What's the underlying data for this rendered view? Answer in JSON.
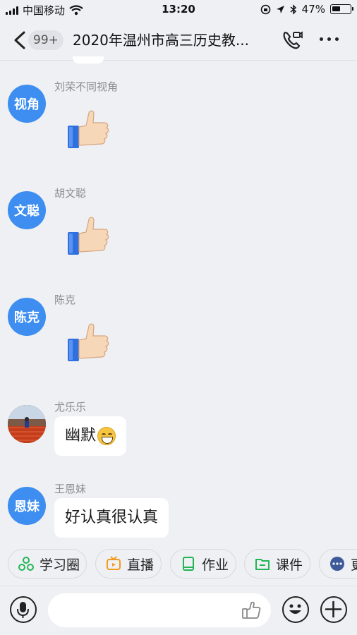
{
  "status_bar": {
    "carrier": "中国移动",
    "time": "13:20",
    "battery_text": "47%",
    "battery_level": 0.47
  },
  "header": {
    "unread_badge": "99+",
    "title": "2020年温州市高三历史教...",
    "icons": [
      "back-icon",
      "phone-call-icon",
      "more-icon"
    ]
  },
  "messages": [
    {
      "avatar_text": "视角",
      "sender": "刘荣不同视角",
      "type": "sticker",
      "sticker": "thumbs-up"
    },
    {
      "avatar_text": "文聪",
      "sender": "胡文聪",
      "type": "sticker",
      "sticker": "thumbs-up"
    },
    {
      "avatar_text": "陈克",
      "sender": "陈克",
      "type": "sticker",
      "sticker": "thumbs-up"
    },
    {
      "avatar_text": "",
      "sender": "尤乐乐",
      "type": "text",
      "text": "幽默",
      "emoji": "grinning-face"
    },
    {
      "avatar_text": "恩妹",
      "sender": "王恩妹",
      "type": "text",
      "text": "好认真很认真"
    }
  ],
  "quick_tabs": [
    {
      "label": "学习圈",
      "icon": "circle-group-icon",
      "color": "#22b455"
    },
    {
      "label": "直播",
      "icon": "tv-icon",
      "color": "#f29b1d"
    },
    {
      "label": "作业",
      "icon": "book-icon",
      "color": "#22b455"
    },
    {
      "label": "课件",
      "icon": "folder-icon",
      "color": "#22b455"
    },
    {
      "label": "更",
      "icon": "more-dots-icon",
      "color": "#3d5a99"
    }
  ],
  "colors": {
    "accent": "#3d8ef0",
    "background": "#eef0f3"
  }
}
